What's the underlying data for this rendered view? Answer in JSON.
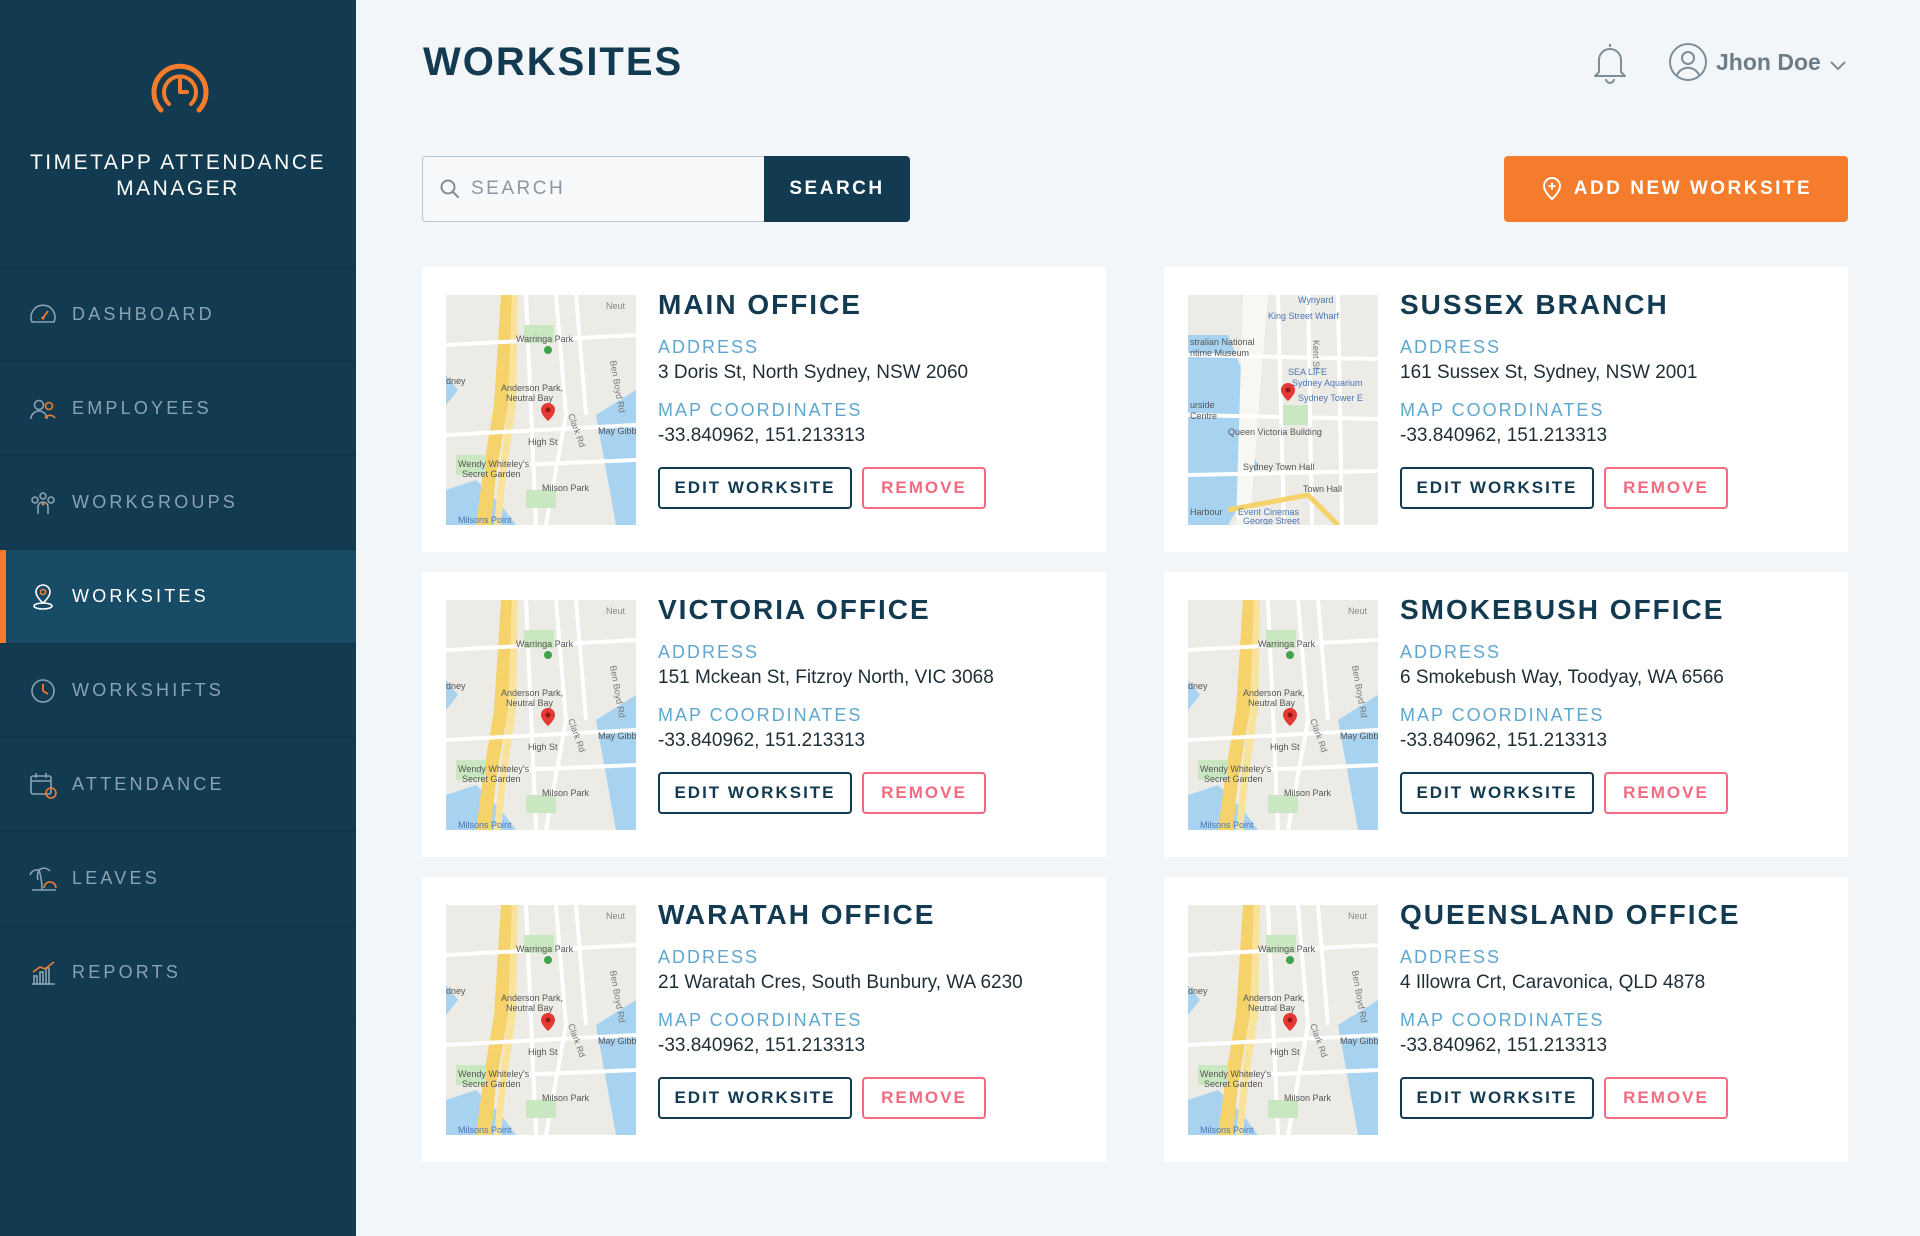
{
  "app": {
    "title": "TIMETAPP ATTENDANCE MANAGER"
  },
  "nav": [
    {
      "label": "DASHBOARD",
      "icon": "dashboard-icon",
      "active": false
    },
    {
      "label": "EMPLOYEES",
      "icon": "employees-icon",
      "active": false
    },
    {
      "label": "WORKGROUPS",
      "icon": "workgroups-icon",
      "active": false
    },
    {
      "label": "WORKSITES",
      "icon": "worksites-icon",
      "active": true
    },
    {
      "label": "WORKSHIFTS",
      "icon": "workshifts-icon",
      "active": false
    },
    {
      "label": "ATTENDANCE",
      "icon": "attendance-icon",
      "active": false
    },
    {
      "label": "LEAVES",
      "icon": "leaves-icon",
      "active": false
    },
    {
      "label": "REPORTS",
      "icon": "reports-icon",
      "active": false
    }
  ],
  "header": {
    "title": "WORKSITES",
    "user_name": "Jhon Doe"
  },
  "search": {
    "placeholder": "SEARCH",
    "value": "",
    "button_label": "SEARCH"
  },
  "add_button_label": "ADD NEW WORKSITE",
  "labels": {
    "address": "ADDRESS",
    "coordinates": "MAP COORDINATES",
    "edit": "EDIT WORKSITE",
    "remove": "REMOVE"
  },
  "worksites": [
    {
      "name": "MAIN OFFICE",
      "address": "3 Doris St, North Sydney, NSW 2060",
      "coordinates": "-33.840962, 151.213313",
      "map": "north-sydney"
    },
    {
      "name": "SUSSEX BRANCH",
      "address": "161 Sussex St, Sydney, NSW 2001",
      "coordinates": "-33.840962, 151.213313",
      "map": "sydney-cbd"
    },
    {
      "name": "VICTORIA OFFICE",
      "address": "151 Mckean St, Fitzroy North, VIC 3068",
      "coordinates": "-33.840962, 151.213313",
      "map": "north-sydney"
    },
    {
      "name": "SMOKEBUSH OFFICE",
      "address": "6 Smokebush Way, Toodyay, WA 6566",
      "coordinates": "-33.840962, 151.213313",
      "map": "north-sydney"
    },
    {
      "name": "WARATAH OFFICE",
      "address": "21 Waratah Cres, South Bunbury, WA 6230",
      "coordinates": "-33.840962, 151.213313",
      "map": "north-sydney"
    },
    {
      "name": "QUEENSLAND OFFICE",
      "address": "4 Illowra Crt, Caravonica, QLD 4878",
      "coordinates": "-33.840962, 151.213313",
      "map": "north-sydney"
    }
  ],
  "map_labels": {
    "north-sydney": [
      "Neut",
      "Warringa Park",
      "Anderson Park,",
      "Neutral Bay",
      "dney",
      "High St",
      "May Gibb",
      "Wendy Whiteley's",
      "Secret Garden",
      "Milson Park",
      "Milsons Point",
      "Clark Rd",
      "Ben Boyd Rd"
    ],
    "sydney-cbd": [
      "Wynyard",
      "King Street Wharf",
      "stralian National",
      "ritime Museum",
      "SEA LIFE",
      "Sydney Aquarium",
      "Sydney Tower E",
      "urside",
      "Centre",
      "Queen Victoria Building",
      "Sydney Town Hall",
      "Town Hall",
      "Harbour",
      "Event Cinemas",
      "George Street",
      "Kent St"
    ]
  },
  "colors": {
    "sidebar": "#123a50",
    "accent": "#f47c2c",
    "label": "#5fa7cf",
    "danger": "#f26b80"
  }
}
